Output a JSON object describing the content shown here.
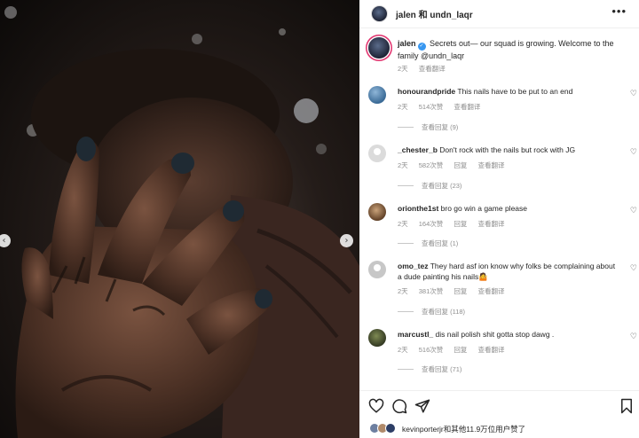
{
  "header": {
    "title": "jalen 和 undn_laqr"
  },
  "caption": {
    "username": "jalen",
    "text": "Secrets out— our squad is growing. Welcome to the family @undn_laqr",
    "time": "2天",
    "translate": "查看翻译"
  },
  "comments": [
    {
      "username": "honourandpride",
      "text": "This nails have to be put to an end",
      "time": "2天",
      "likes": "514次赞",
      "reply": "",
      "translate": "查看翻译",
      "replies": "查看回复 (9)"
    },
    {
      "username": "_chester_b",
      "text": "Don't rock with the nails but rock with JG",
      "time": "2天",
      "likes": "582次赞",
      "reply": "回复",
      "translate": "查看翻译",
      "replies": "查看回复 (23)"
    },
    {
      "username": "orionthe1st",
      "text": "bro go win a game please",
      "time": "2天",
      "likes": "164次赞",
      "reply": "回复",
      "translate": "查看翻译",
      "replies": "查看回复 (1)"
    },
    {
      "username": "omo_tez",
      "text": "They hard asf ion know why folks be complaining about a dude painting his nails🤷",
      "time": "2天",
      "likes": "381次赞",
      "reply": "回复",
      "translate": "查看翻译",
      "replies": "查看回复 (118)"
    },
    {
      "username": "marcustl_",
      "text": "dis nail polish shit gotta stop dawg .",
      "time": "2天",
      "likes": "516次赞",
      "reply": "回复",
      "translate": "查看翻译",
      "replies": "查看回复 (71)"
    }
  ],
  "footer": {
    "likes_text": "kevinporterjr和其他11.9万位用户赞了"
  },
  "icons": {
    "more": "more-horizontal-icon",
    "verified": "verified-badge-icon",
    "heart": "heart-outline-icon",
    "comment": "comment-bubble-icon",
    "share": "paper-plane-icon",
    "save": "bookmark-icon",
    "prev": "chevron-left-icon",
    "next": "chevron-right-icon"
  },
  "colors": {
    "accent": "#3897f0",
    "story_ring": "#e1306c",
    "muted": "#8e8e8e",
    "text": "#262626"
  }
}
